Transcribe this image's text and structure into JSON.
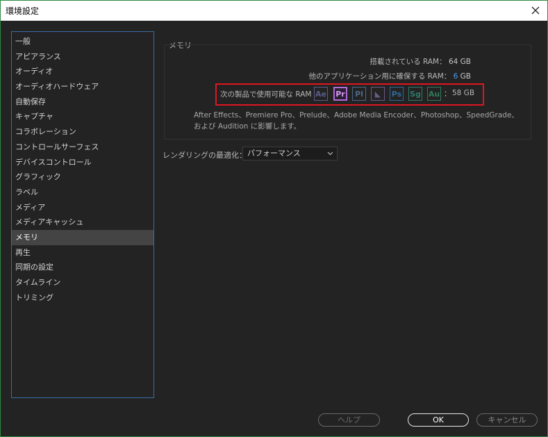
{
  "window": {
    "title": "環境設定"
  },
  "sidebar": {
    "items": [
      {
        "label": "一般"
      },
      {
        "label": "アピアランス"
      },
      {
        "label": "オーディオ"
      },
      {
        "label": "オーディオハードウェア"
      },
      {
        "label": "自動保存"
      },
      {
        "label": "キャプチャ"
      },
      {
        "label": "コラボレーション"
      },
      {
        "label": "コントロールサーフェス"
      },
      {
        "label": "デバイスコントロール"
      },
      {
        "label": "グラフィック"
      },
      {
        "label": "ラベル"
      },
      {
        "label": "メディア"
      },
      {
        "label": "メディアキャッシュ"
      },
      {
        "label": "メモリ",
        "selected": true
      },
      {
        "label": "再生"
      },
      {
        "label": "同期の設定"
      },
      {
        "label": "タイムライン"
      },
      {
        "label": "トリミング"
      }
    ]
  },
  "memory": {
    "group_title": "メモリ",
    "installed_label": "搭載されている RAM：",
    "installed_value": "64 GB",
    "reserved_label": "他のアプリケーション用に確保する RAM：",
    "reserved_value": "6",
    "reserved_unit": "GB",
    "available_label": "次の製品で使用可能な RAM",
    "apps": [
      {
        "abbr": "Ae",
        "color": "#5b5b8c",
        "icon": "after-effects-icon"
      },
      {
        "abbr": "Pr",
        "color": "#b26bd9",
        "icon": "premiere-pro-icon"
      },
      {
        "abbr": "Pl",
        "color": "#4a6a8a",
        "icon": "prelude-icon"
      },
      {
        "abbr": "◣",
        "color": "#6a5a8a",
        "icon": "media-encoder-icon"
      },
      {
        "abbr": "Ps",
        "color": "#2f6a9a",
        "icon": "photoshop-icon"
      },
      {
        "abbr": "Sg",
        "color": "#2f7a6a",
        "icon": "speedgrade-icon"
      },
      {
        "abbr": "Au",
        "color": "#2f7a5a",
        "icon": "audition-icon"
      }
    ],
    "available_colon": "：",
    "available_value": "58 GB",
    "description": "After Effects、Premiere Pro、Prelude、Adobe Media Encoder、Photoshop、SpeedGrade、および Audition に影響します。"
  },
  "render": {
    "label": "レンダリングの最適化：",
    "value": "パフォーマンス"
  },
  "buttons": {
    "help": "ヘルプ",
    "ok": "OK",
    "cancel": "キャンセル"
  },
  "colors": {
    "background": "#232323",
    "highlight": "#e0161f",
    "accent_blue": "#4a9cf5",
    "selection": "#444444"
  }
}
